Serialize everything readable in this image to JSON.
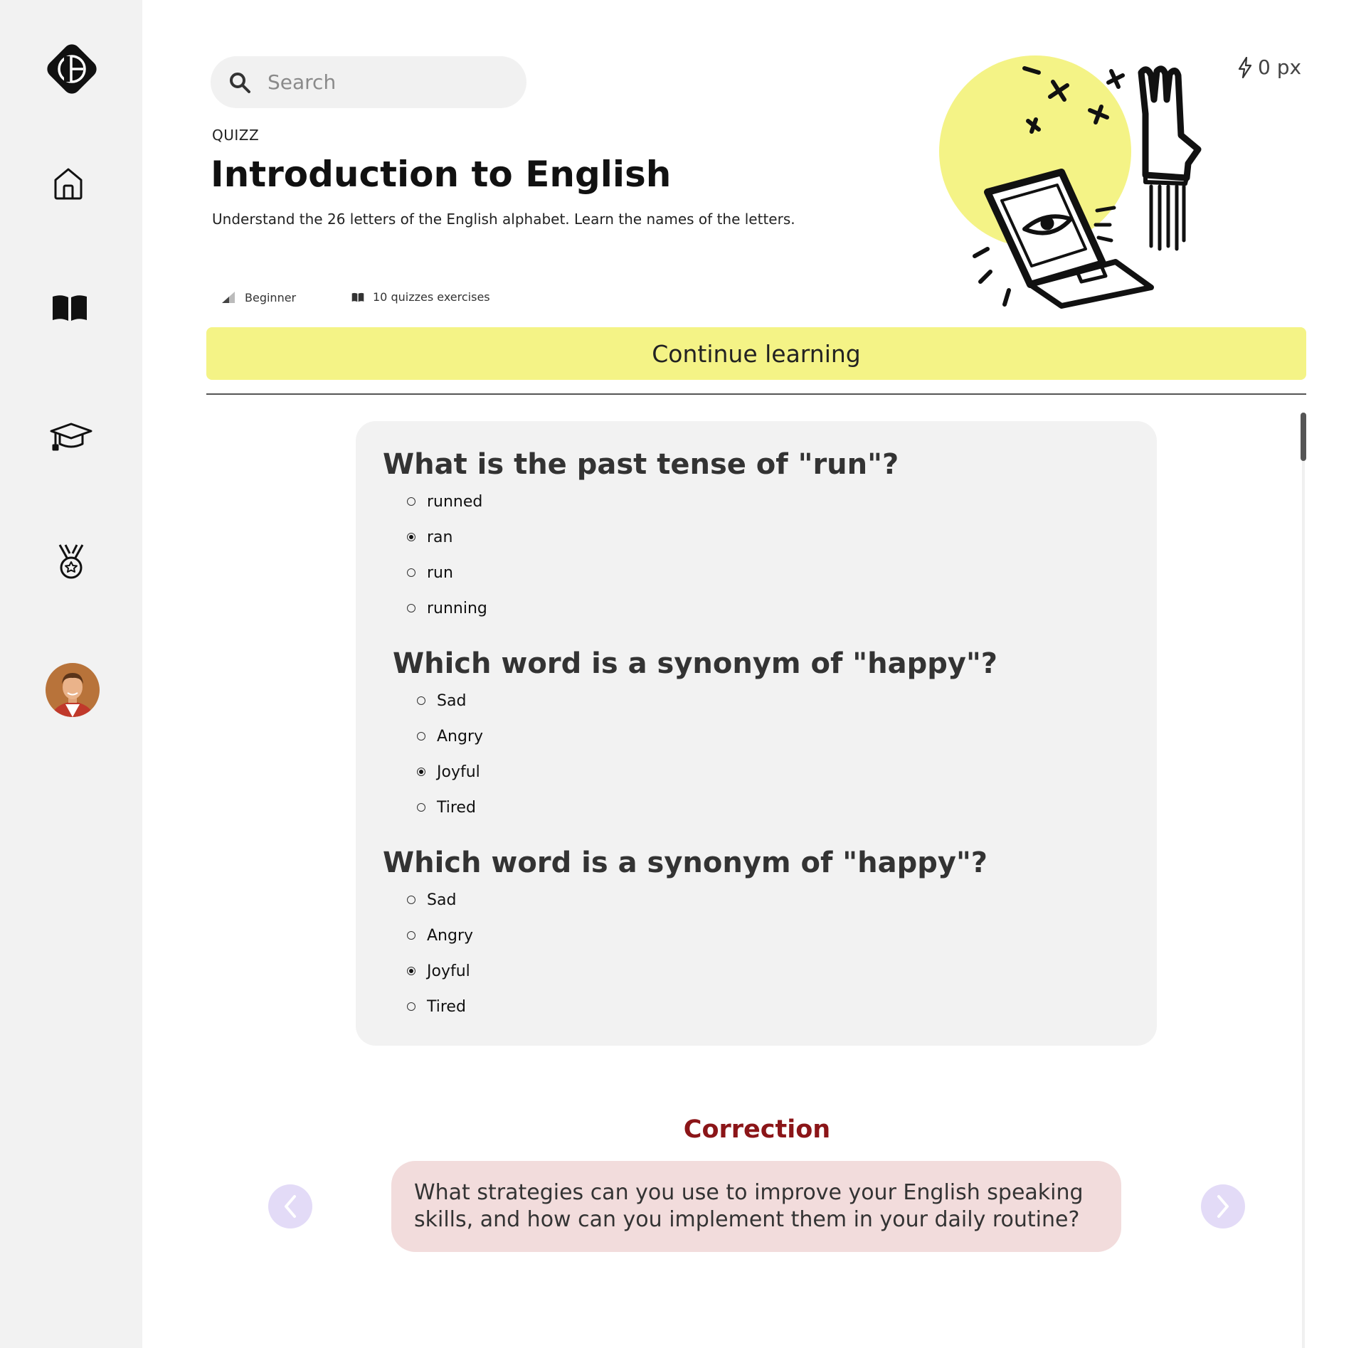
{
  "sidebar": {
    "logo_icon": "g-logo-icon",
    "items": [
      {
        "name": "home",
        "icon": "home-icon"
      },
      {
        "name": "library",
        "icon": "book-icon"
      },
      {
        "name": "courses",
        "icon": "graduation-cap-icon"
      },
      {
        "name": "achievements",
        "icon": "medal-icon"
      }
    ],
    "avatar_icon": "user-avatar"
  },
  "search": {
    "placeholder": "Search",
    "value": ""
  },
  "header": {
    "breadcrumb": "QUIZZ",
    "title": "Introduction to English",
    "subtitle": "Understand the 26 letters of the English alphabet. Learn the names of the letters.",
    "level": "Beginner",
    "count": "10 quizzes exercises",
    "xp": "0 px"
  },
  "cta": {
    "label": "Continue learning"
  },
  "quiz": {
    "questions": [
      {
        "text": "What is the past tense of \"run\"?",
        "options": [
          "runned",
          "ran",
          "run",
          "running"
        ],
        "selected": 1
      },
      {
        "text": "Which word is a synonym of \"happy\"?",
        "options": [
          "Sad",
          "Angry",
          "Joyful",
          "Tired"
        ],
        "selected": 2
      },
      {
        "text": "Which word is a synonym of \"happy\"?",
        "options": [
          "Sad",
          "Angry",
          "Joyful",
          "Tired"
        ],
        "selected": 2
      }
    ]
  },
  "correction": {
    "title": "Correction",
    "text": "What strategies can you use to improve your English speaking skills, and how can you implement them in your daily routine?"
  },
  "colors": {
    "accent_yellow": "#f4f386",
    "sidebar_bg": "#f2f2f2",
    "card_bg": "#f2f2f2",
    "correction_title": "#8b1518",
    "correction_bg": "#f2dcdc",
    "nav_circle": "#e3dbf7"
  }
}
